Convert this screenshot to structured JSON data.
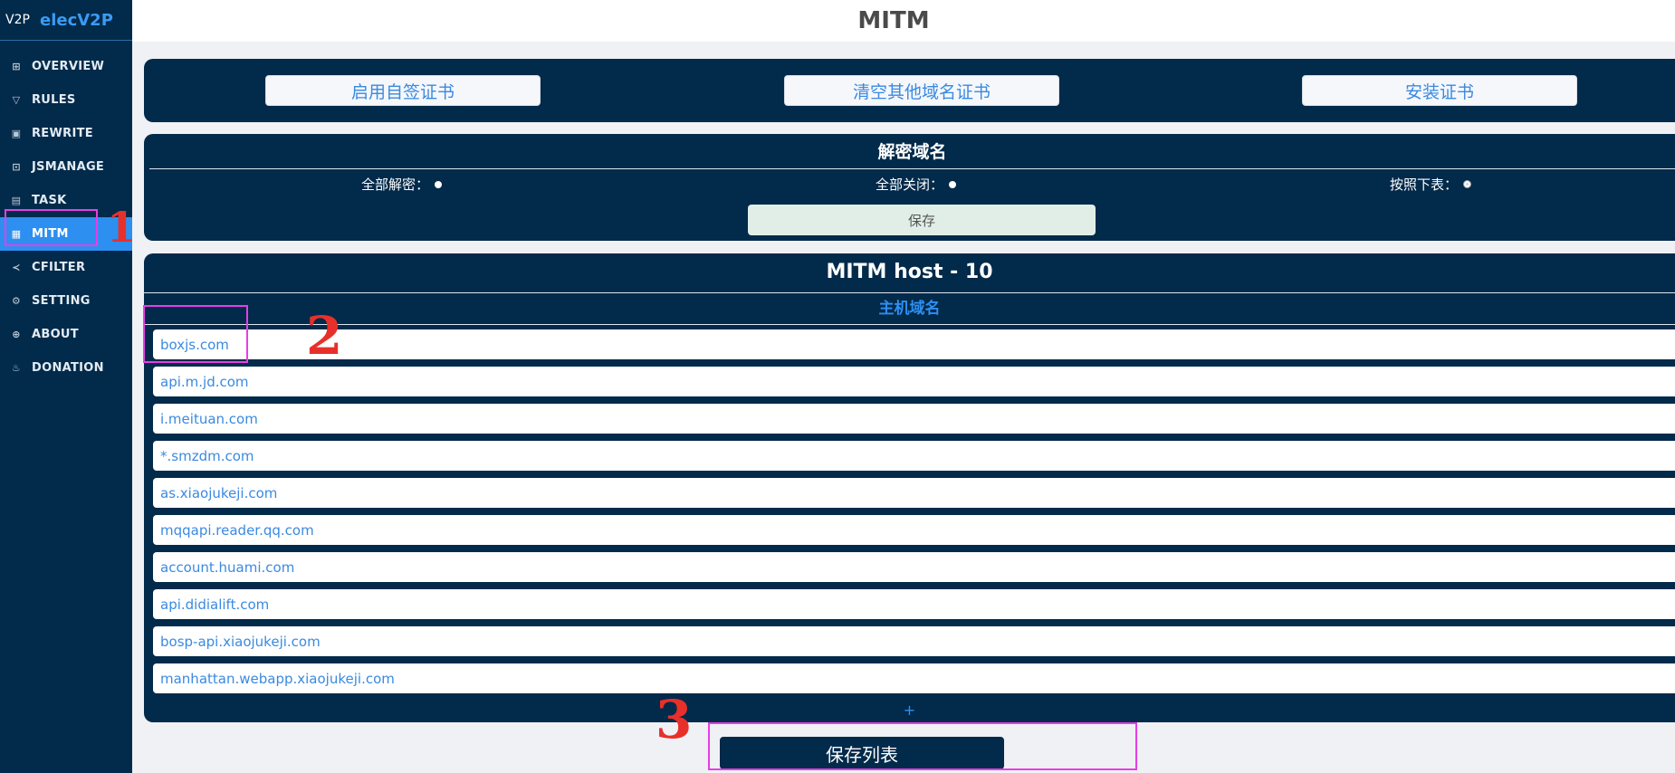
{
  "app": {
    "logo": "V2P",
    "name": "elecV2P",
    "page_title": "MITM"
  },
  "sidebar": {
    "items": [
      {
        "label": "OVERVIEW",
        "icon": "grid-icon"
      },
      {
        "label": "RULES",
        "icon": "filter-icon"
      },
      {
        "label": "REWRITE",
        "icon": "rewrite-icon"
      },
      {
        "label": "JSMANAGE",
        "icon": "script-icon"
      },
      {
        "label": "TASK",
        "icon": "calendar-icon"
      },
      {
        "label": "MITM",
        "icon": "certificate-icon",
        "active": true
      },
      {
        "label": "CFILTER",
        "icon": "share-icon"
      },
      {
        "label": "SETTING",
        "icon": "gear-icon"
      },
      {
        "label": "ABOUT",
        "icon": "globe-icon"
      },
      {
        "label": "DONATION",
        "icon": "cup-icon"
      }
    ]
  },
  "cert_panel": {
    "enable_selfsigned": "启用自签证书",
    "clear_other": "清空其他域名证书",
    "install": "安装证书"
  },
  "decrypt_panel": {
    "title": "解密域名",
    "options": [
      "全部解密：",
      "全部关闭：",
      "按照下表："
    ],
    "selected_index": 2,
    "save_label": "保存"
  },
  "host_panel": {
    "title": "MITM host - 10",
    "column": "主机域名",
    "hosts": [
      "boxjs.com",
      "api.m.jd.com",
      "i.meituan.com",
      "*.smzdm.com",
      "as.xiaojukeji.com",
      "mqqapi.reader.qq.com",
      "account.huami.com",
      "api.didialift.com",
      "bosp-api.xiaojukeji.com",
      "manhattan.webapp.xiaojukeji.com"
    ],
    "add_label": "+"
  },
  "save_list_label": "保存列表",
  "annotations": [
    "1",
    "2",
    "3"
  ],
  "colors": {
    "navy": "#022a4a",
    "accent": "#2d8ff0",
    "highlight": "#e83de6",
    "scribble": "#e8302a"
  }
}
